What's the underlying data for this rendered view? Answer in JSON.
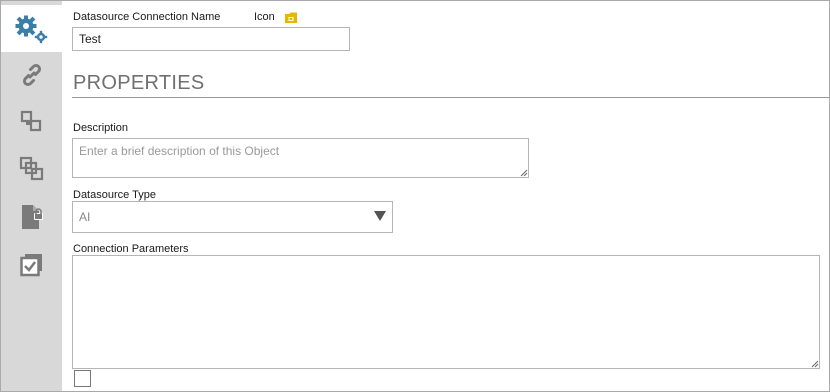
{
  "sidebar": {
    "items": [
      {
        "name": "settings",
        "icon": "gears-icon",
        "active": true
      },
      {
        "name": "link",
        "icon": "link-icon",
        "active": false
      },
      {
        "name": "collapse",
        "icon": "collapse-squares-icon",
        "active": false
      },
      {
        "name": "duplicate",
        "icon": "duplicate-squares-icon",
        "active": false
      },
      {
        "name": "document-lock",
        "icon": "document-lock-icon",
        "active": false
      },
      {
        "name": "checked-box",
        "icon": "checked-box-icon",
        "active": false
      }
    ],
    "colors": {
      "icon": "#7a7a7a",
      "active_icon": "#3a7fa8",
      "background": "#d8d8d8"
    }
  },
  "form": {
    "connection_name_label": "Datasource Connection Name",
    "connection_name_value": "Test",
    "icon_label": "Icon",
    "icon_color": "#e5b700",
    "section_title": "PROPERTIES",
    "description_label": "Description",
    "description_placeholder": "Enter a brief description of this Object",
    "description_value": "",
    "datasource_type_label": "Datasource Type",
    "datasource_type_value": "AI",
    "connection_parameters_label": "Connection Parameters",
    "connection_parameters_value": "",
    "checkbox_checked": false
  }
}
